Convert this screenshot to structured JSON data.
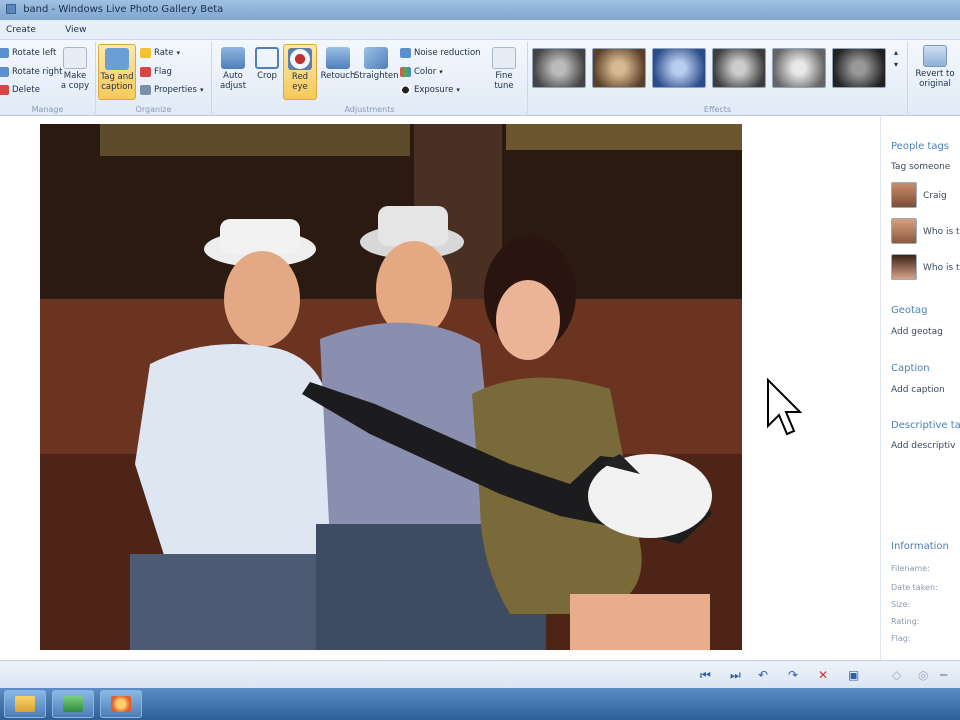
{
  "window": {
    "title": "band - Windows Live Photo Gallery Beta"
  },
  "menu": {
    "items": [
      "Create",
      "View"
    ]
  },
  "ribbon": {
    "manage": {
      "label": "Manage",
      "rotate_left": "Rotate left",
      "rotate_right": "Rotate right",
      "delete": "Delete",
      "make_copy_line1": "Make",
      "make_copy_line2": "a copy"
    },
    "organize": {
      "label": "Organize",
      "tag_caption_line1": "Tag and",
      "tag_caption_line2": "caption",
      "rate": "Rate",
      "flag": "Flag",
      "properties": "Properties"
    },
    "adjustments": {
      "label": "Adjustments",
      "auto_adjust_line1": "Auto",
      "auto_adjust_line2": "adjust",
      "crop": "Crop",
      "red_eye_line1": "Red",
      "red_eye_line2": "eye",
      "retouch": "Retouch",
      "straighten": "Straighten",
      "noise_reduction": "Noise reduction",
      "color": "Color",
      "exposure": "Exposure",
      "fine_tune_line1": "Fine",
      "fine_tune_line2": "tune"
    },
    "effects": {
      "label": "Effects"
    },
    "revert_line1": "Revert to",
    "revert_line2": "original"
  },
  "panel": {
    "people_tags": "People tags",
    "tag_someone": "Tag someone",
    "people": [
      "Craig",
      "Who is t",
      "Who is t"
    ],
    "geotag": "Geotag",
    "add_geotag": "Add geotag",
    "caption": "Caption",
    "add_caption": "Add caption",
    "descriptive_tags": "Descriptive ta",
    "add_descriptive": "Add descriptiv",
    "information": "Information",
    "info_rows": [
      "Filename:",
      "Date taken:",
      "Size:",
      "Rating:",
      "Flag:"
    ]
  },
  "colors": {
    "accent": "#4a7fb8",
    "active_button": "#f6c95a",
    "taskbar": "#2f5f98"
  }
}
